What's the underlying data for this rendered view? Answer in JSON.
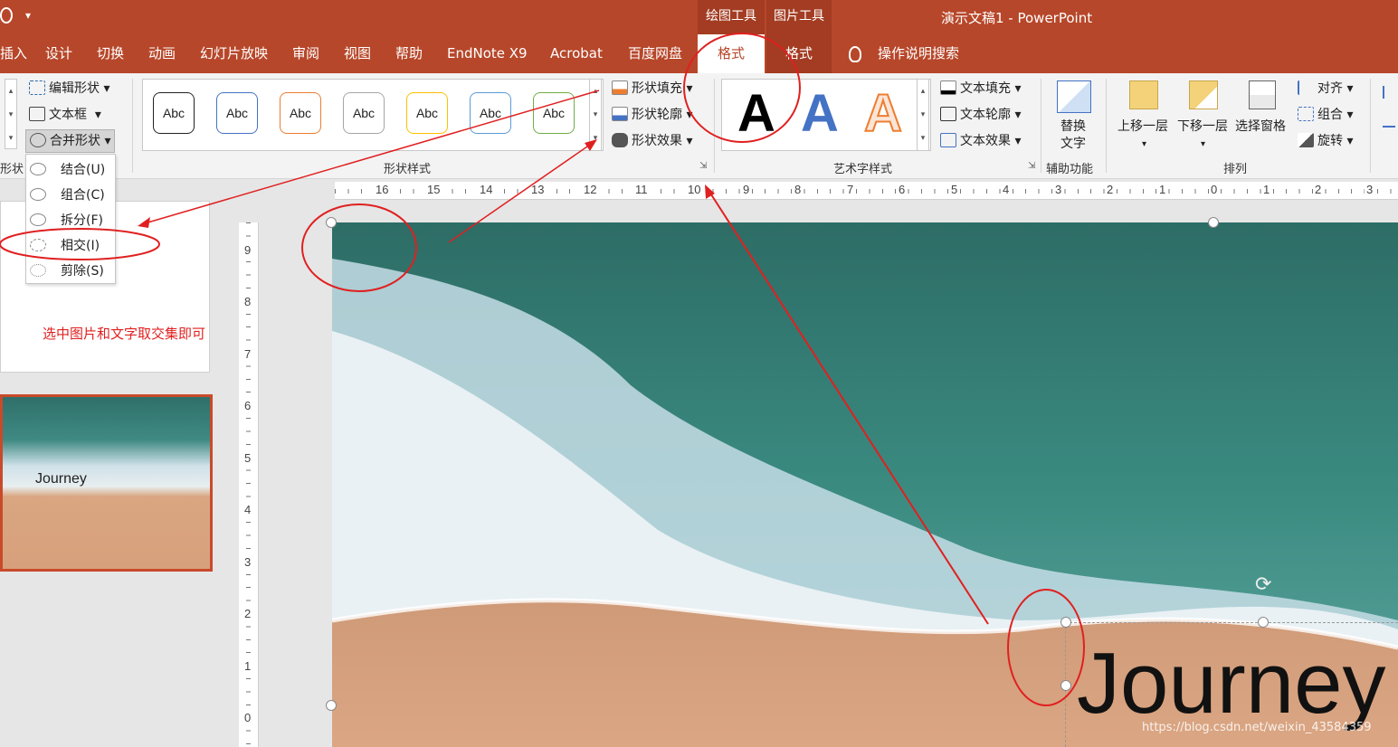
{
  "title_bar": {
    "quick_access": "▾",
    "doc_title": "演示文稿1  -  PowerPoint"
  },
  "context_tabs": {
    "drawing_tools": "绘图工具",
    "picture_tools": "图片工具"
  },
  "tabs": [
    "插入",
    "设计",
    "切换",
    "动画",
    "幻灯片放映",
    "审阅",
    "视图",
    "帮助",
    "EndNote X9",
    "Acrobat",
    "百度网盘",
    "格式",
    "格式"
  ],
  "tell_me": "操作说明搜索",
  "ribbon": {
    "insert_shapes": {
      "edit_shape": "编辑形状",
      "text_box": "文本框",
      "merge_shapes": "合并形状",
      "group_label": "形状"
    },
    "shape_styles": {
      "abc": "Abc",
      "fill": "形状填充",
      "outline": "形状轮廓",
      "effect": "形状效果",
      "group_label": "形状样式"
    },
    "wordart": {
      "letter": "A",
      "text_fill": "文本填充",
      "text_outline": "文本轮廓",
      "text_effect": "文本效果",
      "group_label": "艺术字样式"
    },
    "accessibility": {
      "alt_text_1": "替换",
      "alt_text_2": "文字",
      "group_label": "辅助功能"
    },
    "arrange": {
      "bring_forward": "上移一层",
      "send_backward": "下移一层",
      "selection_pane": "选择窗格",
      "align": "对齐",
      "group": "组合",
      "rotate": "旋转",
      "group_label": "排列"
    }
  },
  "merge_menu": [
    {
      "label": "结合(U)"
    },
    {
      "label": "组合(C)"
    },
    {
      "label": "拆分(F)"
    },
    {
      "label": "相交(I)"
    },
    {
      "label": "剪除(S)"
    }
  ],
  "annotation_note": "选中图片和文字取交集即可",
  "thumbnail_text": "Journey",
  "slide_text": "Journey",
  "h_ruler": [
    "16",
    "15",
    "14",
    "13",
    "12",
    "11",
    "10",
    "9",
    "8",
    "7",
    "6",
    "5",
    "4",
    "3",
    "2",
    "1",
    "0",
    "1",
    "2",
    "3"
  ],
  "v_ruler": [
    "9",
    "8",
    "7",
    "6",
    "5",
    "4",
    "3",
    "2",
    "1",
    "0"
  ],
  "watermark": "https://blog.csdn.net/weixin_43584359",
  "colors": {
    "ribbon_red": "#b7472a",
    "annotation_red": "#e02020",
    "ocean_teal": "#2f7d73",
    "sand": "#d7a07c",
    "foam": "#dce9ef"
  }
}
